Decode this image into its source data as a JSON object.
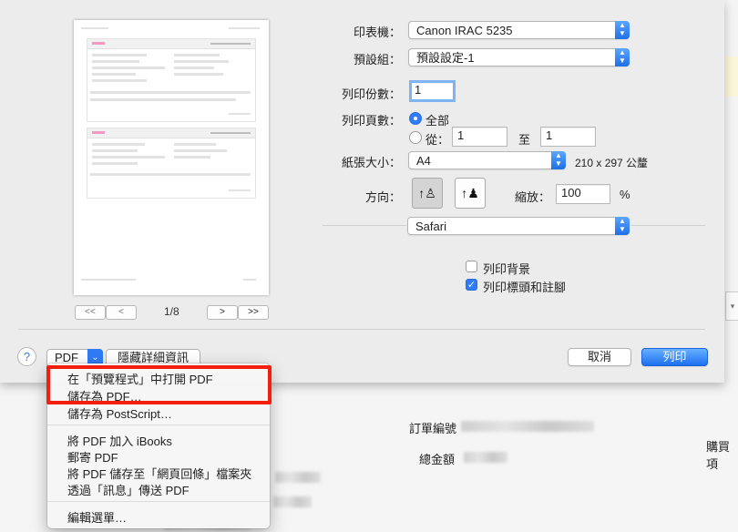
{
  "dialog": {
    "printer_label": "印表機：",
    "printer_value": "Canon IRAC 5235",
    "presets_label": "預設組：",
    "presets_value": "預設設定-1",
    "copies_label": "列印份數：",
    "copies_value": "1",
    "pages_label": "列印頁數：",
    "pages_all": "全部",
    "pages_from": "從：",
    "pages_from_value": "1",
    "pages_to": "至",
    "pages_to_value": "1",
    "paper_label": "紙張大小：",
    "paper_value": "A4",
    "paper_dims": "210 x 297 公釐",
    "orientation_label": "方向：",
    "scale_label": "縮放：",
    "scale_value": "100",
    "scale_unit": "%",
    "app_section": "Safari",
    "print_backgrounds": "列印背景",
    "print_headers": "列印標頭和註腳",
    "pdf_button": "PDF",
    "hide_details": "隱藏詳細資訊",
    "cancel": "取消",
    "print": "列印",
    "help": "?",
    "page_indicator": "1/8",
    "first_page": "<<",
    "prev_page": "<",
    "next_page": ">",
    "last_page": ">>"
  },
  "pdf_menu": {
    "open_in_preview": "在「預覽程式」中打開 PDF",
    "save_as_pdf": "儲存為 PDF…",
    "save_as_postscript": "儲存為 PostScript…",
    "add_to_ibooks": "將 PDF 加入 iBooks",
    "mail_pdf": "郵寄 PDF",
    "save_to_web_receipts": "將 PDF 儲存至「網頁回條」檔案夾",
    "send_via_messages": "透過「訊息」傳送 PDF",
    "edit_menu": "編輯選單…"
  },
  "background_page": {
    "order_number_label": "訂單編號",
    "total_label": "總金額",
    "buyer_label": "購買項"
  },
  "colors": {
    "accent": "#2f7cf6",
    "highlight_border": "#f21f0f"
  }
}
